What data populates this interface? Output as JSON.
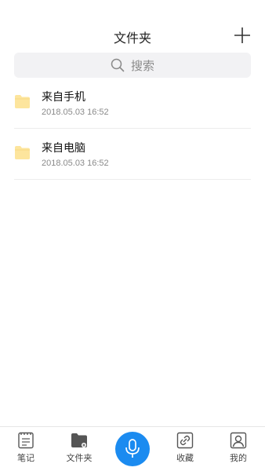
{
  "header": {
    "title": "文件夹"
  },
  "search": {
    "placeholder": "搜索"
  },
  "folders": [
    {
      "name": "来自手机",
      "date": "2018.05.03 16:52"
    },
    {
      "name": "来自电脑",
      "date": "2018.05.03 16:52"
    }
  ],
  "tabbar": {
    "notes": "笔记",
    "folder": "文件夹",
    "favorites": "收藏",
    "mine": "我的"
  },
  "colors": {
    "accent": "#1b8bf0",
    "folder": "#fde59d"
  },
  "icons": [
    "plus-icon",
    "search-icon",
    "folder-icon",
    "notes-icon",
    "microphone-icon",
    "link-icon",
    "profile-icon"
  ]
}
